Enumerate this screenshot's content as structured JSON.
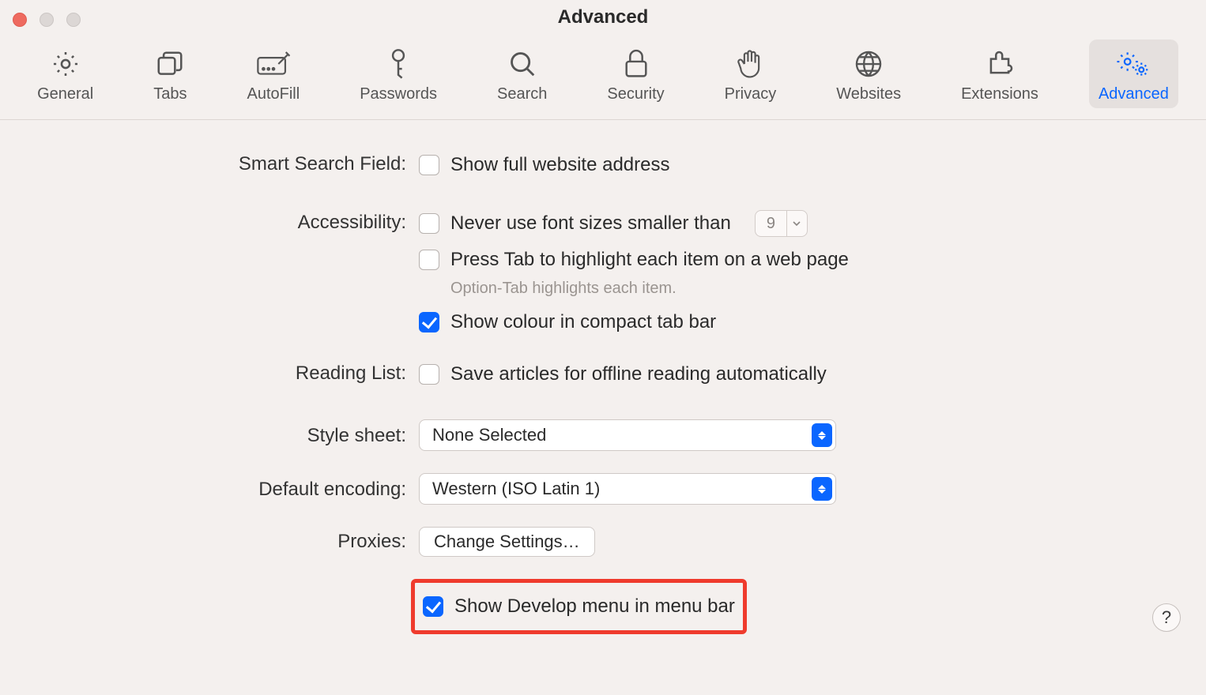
{
  "window_title": "Advanced",
  "tabs": {
    "general": "General",
    "tabs": "Tabs",
    "autofill": "AutoFill",
    "passwords": "Passwords",
    "search": "Search",
    "security": "Security",
    "privacy": "Privacy",
    "websites": "Websites",
    "extensions": "Extensions",
    "advanced": "Advanced"
  },
  "sections": {
    "smart_search": {
      "label": "Smart Search Field:",
      "opt1": "Show full website address"
    },
    "accessibility": {
      "label": "Accessibility:",
      "opt1": "Never use font sizes smaller than",
      "font_size": "9",
      "opt2": "Press Tab to highlight each item on a web page",
      "hint": "Option-Tab highlights each item.",
      "opt3": "Show colour in compact tab bar"
    },
    "reading_list": {
      "label": "Reading List:",
      "opt1": "Save articles for offline reading automatically"
    },
    "style_sheet": {
      "label": "Style sheet:",
      "value": "None Selected"
    },
    "encoding": {
      "label": "Default encoding:",
      "value": "Western (ISO Latin 1)"
    },
    "proxies": {
      "label": "Proxies:",
      "button": "Change Settings…"
    },
    "develop": {
      "label": "",
      "opt1": "Show Develop menu in menu bar"
    }
  },
  "help_label": "?"
}
